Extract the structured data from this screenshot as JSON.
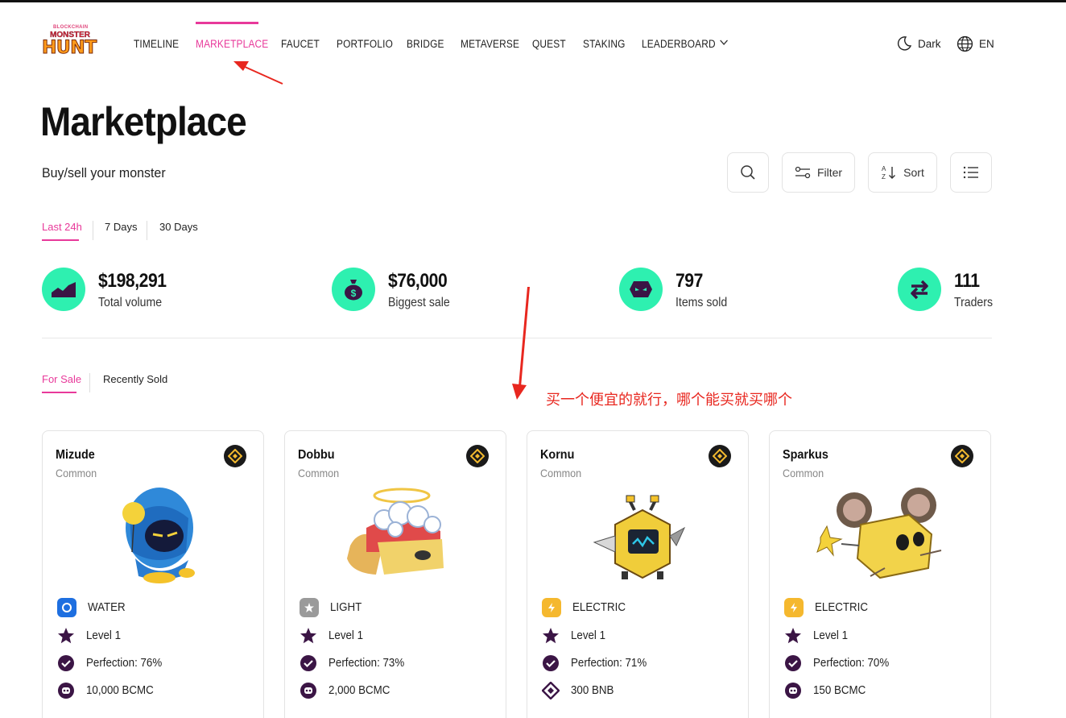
{
  "colors": {
    "accent": "#e8399a",
    "mint": "#2ef0b0",
    "dark_purple": "#3b1545",
    "annotation_red": "#e8271f",
    "binance_gold": "#f3ba2f"
  },
  "logo": {
    "line1": "BLOCKCHAIN",
    "line2": "MONSTER",
    "line3": "HUNT"
  },
  "nav": {
    "items": [
      {
        "label": "TIMELINE",
        "active": false
      },
      {
        "label": "MARKETPLACE",
        "active": true
      },
      {
        "label": "FAUCET",
        "active": false
      },
      {
        "label": "PORTFOLIO",
        "active": false
      },
      {
        "label": "BRIDGE",
        "active": false
      },
      {
        "label": "METAVERSE",
        "active": false
      },
      {
        "label": "QUEST",
        "active": false
      },
      {
        "label": "STAKING",
        "active": false
      },
      {
        "label": "LEADERBOARD",
        "active": false,
        "icon": "chevron-down-icon"
      }
    ],
    "theme_label": "Dark",
    "lang_label": "EN"
  },
  "page": {
    "title": "Marketplace",
    "subtitle": "Buy/sell your monster"
  },
  "toolbar": {
    "filter_label": "Filter",
    "sort_label": "Sort"
  },
  "time_tabs": [
    {
      "label": "Last 24h",
      "active": true
    },
    {
      "label": "7 Days",
      "active": false
    },
    {
      "label": "30 Days",
      "active": false
    }
  ],
  "stats": [
    {
      "value": "$198,291",
      "label": "Total volume",
      "icon": "chart-area-icon"
    },
    {
      "value": "$76,000",
      "label": "Biggest sale",
      "icon": "money-bag-icon"
    },
    {
      "value": "797",
      "label": "Items sold",
      "icon": "monster-face-icon"
    },
    {
      "value": "111",
      "label": "Traders",
      "icon": "swap-arrows-icon"
    }
  ],
  "sale_tabs": [
    {
      "label": "For Sale",
      "active": true
    },
    {
      "label": "Recently Sold",
      "active": false
    }
  ],
  "annotation": {
    "text": "买一个便宜的就行，哪个能买就买哪个"
  },
  "cards": [
    {
      "name": "Mizude",
      "rarity": "Common",
      "element": "WATER",
      "element_color": "#1e6fe0",
      "level": "Level 1",
      "perfection": "Perfection: 76%",
      "price": "10,000 BCMC",
      "price_icon": "bcmc-token-icon"
    },
    {
      "name": "Dobbu",
      "rarity": "Common",
      "element": "LIGHT",
      "element_color": "#9a9a9a",
      "level": "Level 1",
      "perfection": "Perfection: 73%",
      "price": "2,000 BCMC",
      "price_icon": "bcmc-token-icon"
    },
    {
      "name": "Kornu",
      "rarity": "Common",
      "element": "ELECTRIC",
      "element_color": "#f5b82e",
      "level": "Level 1",
      "perfection": "Perfection: 71%",
      "price": "300 BNB",
      "price_icon": "bnb-token-icon"
    },
    {
      "name": "Sparkus",
      "rarity": "Common",
      "element": "ELECTRIC",
      "element_color": "#f5b82e",
      "level": "Level 1",
      "perfection": "Perfection: 70%",
      "price": "150 BCMC",
      "price_icon": "bcmc-token-icon"
    }
  ]
}
